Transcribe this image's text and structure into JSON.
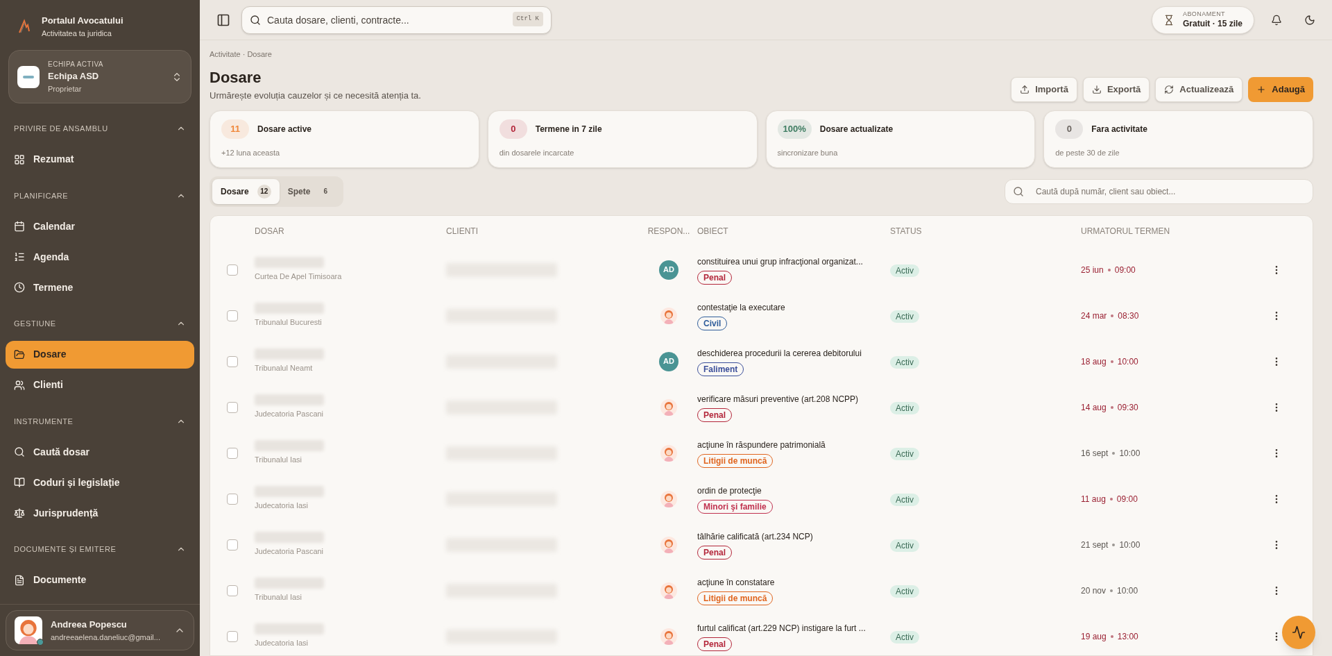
{
  "brand": {
    "title": "Portalul Avocatului",
    "subtitle": "Activitatea ta juridica"
  },
  "team": {
    "caption": "ECHIPA ACTIVA",
    "name": "Echipa ASD",
    "role": "Proprietar"
  },
  "sidebar": {
    "sections": [
      {
        "title": "PRIVIRE DE ANSAMBLU",
        "expanded": true,
        "items": [
          {
            "label": "Rezumat",
            "selected": false
          }
        ]
      },
      {
        "title": "PLANIFICARE",
        "expanded": true,
        "items": [
          {
            "label": "Calendar",
            "selected": false
          },
          {
            "label": "Agenda",
            "selected": false
          },
          {
            "label": "Termene",
            "selected": false
          }
        ]
      },
      {
        "title": "GESTIUNE",
        "expanded": true,
        "items": [
          {
            "label": "Dosare",
            "selected": true
          },
          {
            "label": "Clienti",
            "selected": false
          }
        ]
      },
      {
        "title": "INSTRUMENTE",
        "expanded": true,
        "items": [
          {
            "label": "Caută dosar",
            "selected": false
          },
          {
            "label": "Coduri și legislație",
            "selected": false
          },
          {
            "label": "Jurisprudență",
            "selected": false
          }
        ]
      },
      {
        "title": "DOCUMENTE ȘI EMITERE",
        "expanded": true,
        "items": [
          {
            "label": "Documente",
            "selected": false
          }
        ]
      }
    ]
  },
  "user": {
    "name": "Andreea Popescu",
    "email": "andreeaelena.daneliuc@gmail..."
  },
  "topbar": {
    "search_placeholder": "Cauta dosare, clienti, contracte...",
    "shortcut": "Ctrl K",
    "subscription_caption": "ABONAMENT",
    "subscription": "Gratuit · 15 zile"
  },
  "breadcrumb": "Activitate · Dosare",
  "page": {
    "title": "Dosare",
    "subtitle": "Urmărește evoluția cauzelor și ce necesită atenția ta."
  },
  "actions": [
    {
      "label": "Importă",
      "kind": "secondary"
    },
    {
      "label": "Exportă",
      "kind": "secondary"
    },
    {
      "label": "Actualizează",
      "kind": "secondary"
    },
    {
      "label": "Adaugă",
      "kind": "primary"
    }
  ],
  "stats": [
    {
      "value": "11",
      "label": "Dosare active",
      "note": "+12 luna aceasta",
      "color": "#f0873a"
    },
    {
      "value": "0",
      "label": "Termene in 7 zile",
      "note": "din dosarele incarcate",
      "color": "#b3263a"
    },
    {
      "value": "100%",
      "label": "Dosare actualizate",
      "note": "sincronizare buna",
      "color": "#3f7d62"
    },
    {
      "value": "0",
      "label": "Fara activitate",
      "note": "de peste 30 de zile",
      "color": "#6b6560"
    }
  ],
  "tabs": [
    {
      "label": "Dosare",
      "count": "12",
      "selected": true
    },
    {
      "label": "Spete",
      "count": "6",
      "selected": false
    }
  ],
  "table_search_placeholder": "Caută după număr, client sau obiect...",
  "table": {
    "columns": [
      "DOSAR",
      "CLIENTI",
      "RESPON...",
      "OBIECT",
      "STATUS",
      "URMATORUL TERMEN"
    ],
    "rows": [
      {
        "checked": false,
        "court": "Curtea De Apel Timisoara",
        "responsible": {
          "kind": "initials",
          "text": "AD"
        },
        "object": "constituirea unui grup infracţional organizat...",
        "tag": {
          "label": "Penal",
          "color": "#b3263a"
        },
        "status": "Activ",
        "date": "25 iun",
        "time": "09:00",
        "urgent": true
      },
      {
        "checked": false,
        "court": "Tribunalul Bucuresti",
        "responsible": {
          "kind": "avatar"
        },
        "object": "contestaţie la executare",
        "tag": {
          "label": "Civil",
          "color": "#2f5d9a"
        },
        "status": "Activ",
        "date": "24 mar",
        "time": "08:30",
        "urgent": true
      },
      {
        "checked": false,
        "court": "Tribunalul Neamt",
        "responsible": {
          "kind": "initials",
          "text": "AD"
        },
        "object": "deschiderea procedurii la cererea debitorului",
        "tag": {
          "label": "Faliment",
          "color": "#3b4f9a"
        },
        "status": "Activ",
        "date": "18 aug",
        "time": "10:00",
        "urgent": true
      },
      {
        "checked": false,
        "court": "Judecatoria Pascani",
        "responsible": {
          "kind": "avatar"
        },
        "object": "verificare măsuri preventive (art.208 NCPP)",
        "tag": {
          "label": "Penal",
          "color": "#b3263a"
        },
        "status": "Activ",
        "date": "14 aug",
        "time": "09:30",
        "urgent": true
      },
      {
        "checked": false,
        "court": "Tribunalul Iasi",
        "responsible": {
          "kind": "avatar"
        },
        "object": "acţiune în răspundere patrimonială",
        "tag": {
          "label": "Litigii de muncă",
          "color": "#e0651f"
        },
        "status": "Activ",
        "date": "16 sept",
        "time": "10:00",
        "urgent": false
      },
      {
        "checked": false,
        "court": "Judecatoria Iasi",
        "responsible": {
          "kind": "avatar"
        },
        "object": "ordin de protecţie",
        "tag": {
          "label": "Minori şi familie",
          "color": "#c0314f"
        },
        "status": "Activ",
        "date": "11 aug",
        "time": "09:00",
        "urgent": true
      },
      {
        "checked": false,
        "court": "Judecatoria Pascani",
        "responsible": {
          "kind": "avatar"
        },
        "object": "tâlhărie calificată (art.234 NCP)",
        "tag": {
          "label": "Penal",
          "color": "#b3263a"
        },
        "status": "Activ",
        "date": "21 sept",
        "time": "10:00",
        "urgent": false
      },
      {
        "checked": false,
        "court": "Tribunalul Iasi",
        "responsible": {
          "kind": "avatar"
        },
        "object": "acţiune în constatare",
        "tag": {
          "label": "Litigii de muncă",
          "color": "#e0651f"
        },
        "status": "Activ",
        "date": "20 nov",
        "time": "10:00",
        "urgent": false
      },
      {
        "checked": false,
        "court": "Judecatoria Iasi",
        "responsible": {
          "kind": "avatar"
        },
        "object": "furtul calificat (art.229 NCP) instigare la furt ...",
        "tag": {
          "label": "Penal",
          "color": "#b3263a"
        },
        "status": "Activ",
        "date": "19 aug",
        "time": "13:00",
        "urgent": true
      }
    ]
  }
}
